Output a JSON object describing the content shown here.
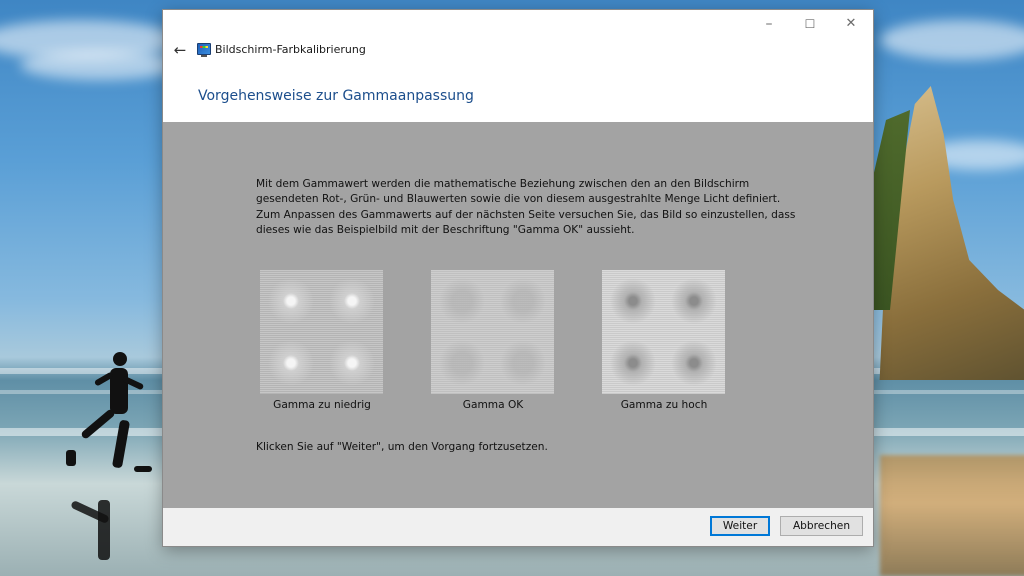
{
  "window": {
    "title": "Bildschirm-Farbkalibrierung",
    "heading": "Vorgehensweise zur Gammaanpassung",
    "controls": {
      "minimize": "–",
      "maximize": "☐",
      "close": "✕"
    },
    "back_icon": "←"
  },
  "content": {
    "intro_paragraphs": [
      "Mit dem Gammawert werden die mathematische Beziehung zwischen den an den Bildschirm gesendeten Rot-, Grün- und Blauwerten sowie die von diesem ausgestrahlte Menge Licht definiert.",
      "Zum Anpassen des Gammawerts auf der nächsten Seite versuchen Sie, das Bild so einzustellen, dass dieses wie das Beispielbild mit der Beschriftung \"Gamma OK\" aussieht."
    ],
    "samples": [
      {
        "label": "Gamma zu niedrig"
      },
      {
        "label": "Gamma OK"
      },
      {
        "label": "Gamma zu hoch"
      }
    ],
    "continue_hint": "Klicken Sie auf \"Weiter\", um den Vorgang fortzusetzen."
  },
  "footer": {
    "next_label": "Weiter",
    "cancel_label": "Abbrechen"
  },
  "colors": {
    "heading": "#1c4e8c",
    "content_bg": "#a3a3a3",
    "primary_border": "#0078d7"
  }
}
